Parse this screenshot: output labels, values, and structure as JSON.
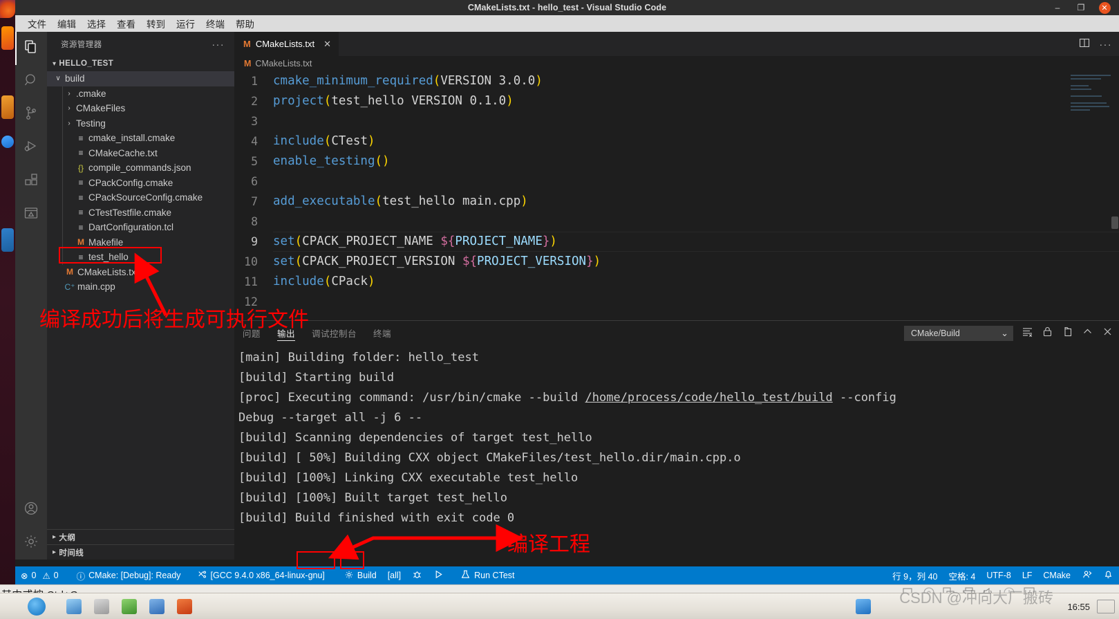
{
  "window": {
    "title": "CMakeLists.txt - hello_test - Visual Studio Code",
    "minimize": "–",
    "maximize": "❐",
    "close": "✕"
  },
  "menubar": {
    "items": [
      "文件",
      "编辑",
      "选择",
      "查看",
      "转到",
      "运行",
      "终端",
      "帮助"
    ]
  },
  "activitybar": {
    "items": [
      {
        "name": "explorer",
        "glyph": "files-icon"
      },
      {
        "name": "search",
        "glyph": "search-icon"
      },
      {
        "name": "source-control",
        "glyph": "branch-icon"
      },
      {
        "name": "run-debug",
        "glyph": "run-debug-icon"
      },
      {
        "name": "extensions",
        "glyph": "extensions-icon"
      },
      {
        "name": "cmake",
        "glyph": "cmake-icon"
      }
    ],
    "accounts": "account-icon",
    "settings": "gear-icon"
  },
  "sidebar": {
    "header": "资源管理器",
    "more": "···",
    "project": "HELLO_TEST",
    "tree": [
      {
        "label": "build",
        "icon": "folder",
        "indent": 1,
        "twisty": "⌄",
        "selected": true
      },
      {
        "label": ".cmake",
        "icon": "folder",
        "indent": 2,
        "twisty": "›"
      },
      {
        "label": "CMakeFiles",
        "icon": "folder",
        "indent": 2,
        "twisty": "›"
      },
      {
        "label": "Testing",
        "icon": "folder",
        "indent": 2,
        "twisty": "›"
      },
      {
        "label": "cmake_install.cmake",
        "icon": "cmake",
        "indent": 2
      },
      {
        "label": "CMakeCache.txt",
        "icon": "cmake",
        "indent": 2
      },
      {
        "label": "compile_commands.json",
        "icon": "json",
        "indent": 2
      },
      {
        "label": "CPackConfig.cmake",
        "icon": "cmake",
        "indent": 2
      },
      {
        "label": "CPackSourceConfig.cmake",
        "icon": "cmake",
        "indent": 2
      },
      {
        "label": "CTestTestfile.cmake",
        "icon": "cmake",
        "indent": 2
      },
      {
        "label": "DartConfiguration.tcl",
        "icon": "cmake",
        "indent": 2
      },
      {
        "label": "Makefile",
        "icon": "make",
        "indent": 2
      },
      {
        "label": "test_hello",
        "icon": "cmake",
        "indent": 2,
        "highlighted": true
      },
      {
        "label": "CMakeLists.txt",
        "icon": "make",
        "indent": 1
      },
      {
        "label": "main.cpp",
        "icon": "cpp",
        "indent": 1
      }
    ],
    "outline": "大纲",
    "timeline": "时间线"
  },
  "editor": {
    "tab": {
      "label": "CMakeLists.txt",
      "icon": "M",
      "close": "✕"
    },
    "actions": [
      "split-editor-icon",
      "more-actions-icon"
    ],
    "breadcrumb": {
      "icon": "M",
      "label": "CMakeLists.txt"
    },
    "lines": [
      {
        "n": 1,
        "tokens": [
          {
            "t": "fn",
            "v": "cmake_minimum_required"
          },
          {
            "t": "par",
            "v": "("
          },
          {
            "t": "arg",
            "v": "VERSION 3.0.0"
          },
          {
            "t": "par",
            "v": ")"
          }
        ]
      },
      {
        "n": 2,
        "tokens": [
          {
            "t": "fn",
            "v": "project"
          },
          {
            "t": "par",
            "v": "("
          },
          {
            "t": "arg",
            "v": "test_hello VERSION 0.1.0"
          },
          {
            "t": "par",
            "v": ")"
          }
        ]
      },
      {
        "n": 3,
        "tokens": []
      },
      {
        "n": 4,
        "tokens": [
          {
            "t": "fn",
            "v": "include"
          },
          {
            "t": "par",
            "v": "("
          },
          {
            "t": "arg",
            "v": "CTest"
          },
          {
            "t": "par",
            "v": ")"
          }
        ]
      },
      {
        "n": 5,
        "tokens": [
          {
            "t": "fn",
            "v": "enable_testing"
          },
          {
            "t": "par",
            "v": "()"
          }
        ]
      },
      {
        "n": 6,
        "tokens": []
      },
      {
        "n": 7,
        "tokens": [
          {
            "t": "fn",
            "v": "add_executable"
          },
          {
            "t": "par",
            "v": "("
          },
          {
            "t": "arg",
            "v": "test_hello main.cpp"
          },
          {
            "t": "par",
            "v": ")"
          }
        ]
      },
      {
        "n": 8,
        "tokens": []
      },
      {
        "n": 9,
        "current": true,
        "tokens": [
          {
            "t": "fn",
            "v": "set"
          },
          {
            "t": "par",
            "v": "("
          },
          {
            "t": "arg",
            "v": "CPACK_PROJECT_NAME "
          },
          {
            "t": "brk",
            "v": "${"
          },
          {
            "t": "var",
            "v": "PROJECT_NAME"
          },
          {
            "t": "brk",
            "v": "}"
          },
          {
            "t": "par",
            "v": ")"
          }
        ]
      },
      {
        "n": 10,
        "tokens": [
          {
            "t": "fn",
            "v": "set"
          },
          {
            "t": "par",
            "v": "("
          },
          {
            "t": "arg",
            "v": "CPACK_PROJECT_VERSION "
          },
          {
            "t": "brk",
            "v": "${"
          },
          {
            "t": "var",
            "v": "PROJECT_VERSION"
          },
          {
            "t": "brk",
            "v": "}"
          },
          {
            "t": "par",
            "v": ")"
          }
        ]
      },
      {
        "n": 11,
        "tokens": [
          {
            "t": "fn",
            "v": "include"
          },
          {
            "t": "par",
            "v": "("
          },
          {
            "t": "arg",
            "v": "CPack"
          },
          {
            "t": "par",
            "v": ")"
          }
        ]
      },
      {
        "n": 12,
        "tokens": []
      }
    ]
  },
  "panel": {
    "tabs": [
      {
        "label": "问题",
        "active": false
      },
      {
        "label": "输出",
        "active": true
      },
      {
        "label": "调试控制台",
        "active": false
      },
      {
        "label": "终端",
        "active": false
      }
    ],
    "output_channel": "CMake/Build",
    "chevron": "⌄",
    "actions": [
      "clear-output-icon",
      "lock-scroll-icon",
      "open-in-editor-icon",
      "collapse-panel-icon",
      "close-panel-icon"
    ],
    "log": [
      {
        "pre": "[main] Building folder: hello_test"
      },
      {
        "pre": "[build] Starting build"
      },
      {
        "pre": "[proc] Executing command: /usr/bin/cmake --build ",
        "link": "/home/process/code/hello_test/build",
        "post": " --config"
      },
      {
        "pre": "Debug --target all -j 6 --"
      },
      {
        "pre": "[build] Scanning dependencies of target test_hello"
      },
      {
        "pre": "[build] [ 50%] Building CXX object CMakeFiles/test_hello.dir/main.cpp.o"
      },
      {
        "pre": "[build] [100%] Linking CXX executable test_hello"
      },
      {
        "pre": "[build] [100%] Built target test_hello"
      },
      {
        "pre": "[build] Build finished with exit code 0"
      }
    ]
  },
  "statusbar": {
    "left": [
      {
        "name": "problems",
        "icon": "⊗",
        "text": "0",
        "icon2": "⚠",
        "text2": "0"
      },
      {
        "name": "cmake-status",
        "icon": "ⓘ",
        "text": "CMake: [Debug]: Ready"
      },
      {
        "name": "cmake-kit",
        "icon": "✂",
        "text": "[GCC 9.4.0 x86_64-linux-gnu]"
      },
      {
        "name": "build",
        "icon": "⚙",
        "text": "Build"
      },
      {
        "name": "build-target",
        "icon": "",
        "text": "[all]"
      },
      {
        "name": "debug",
        "icon": "🐞",
        "text": ""
      },
      {
        "name": "launch",
        "icon": "▷",
        "text": ""
      },
      {
        "name": "run-ctest",
        "icon": "⚗",
        "text": "Run CTest"
      }
    ],
    "right": [
      {
        "name": "cursor-position",
        "text": "行 9，列 40"
      },
      {
        "name": "indentation",
        "text": "空格: 4"
      },
      {
        "name": "encoding",
        "text": "UTF-8"
      },
      {
        "name": "eol",
        "text": "LF"
      },
      {
        "name": "language-mode",
        "text": "CMake"
      },
      {
        "name": "feedback",
        "text": "❀"
      },
      {
        "name": "notifications",
        "text": "⚑"
      }
    ]
  },
  "annotations": [
    {
      "name": "annotation-executable",
      "text": "编译成功后将生成可执行文件"
    },
    {
      "name": "annotation-build",
      "text": "编译工程"
    }
  ],
  "desktop": {
    "os_hint": "其中或按 Ctrl+G。",
    "clock": "16:55",
    "watermark": "CSDN @冲向大厂搬砖"
  }
}
